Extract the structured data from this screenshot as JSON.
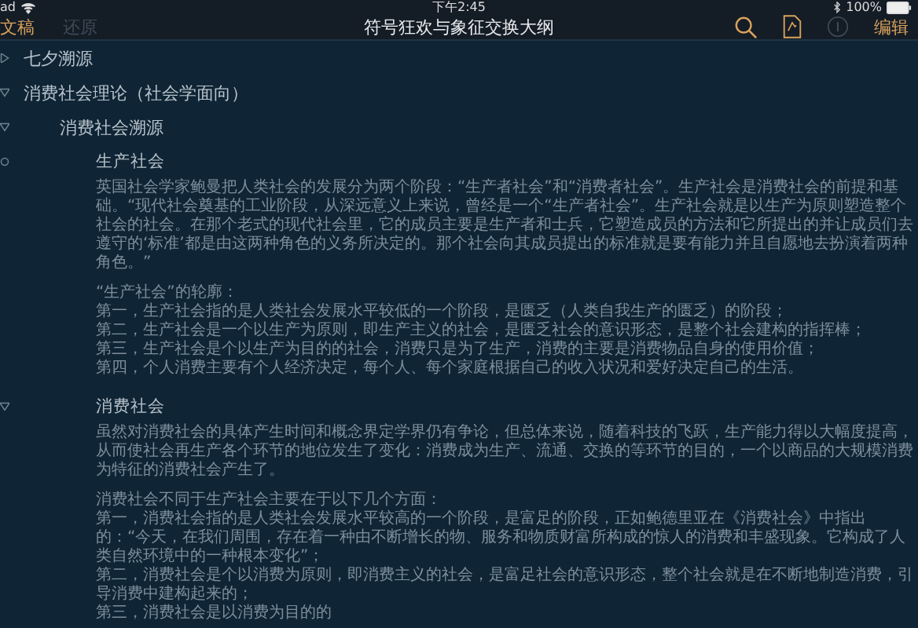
{
  "status_bar": {
    "device": "ad",
    "time": "下午2:45",
    "battery": "100%"
  },
  "nav": {
    "back": "文稿",
    "revert": {
      "label": "还原",
      "disabled": true
    },
    "title": "符号狂欢与象征交换大纲",
    "info_disabled": true,
    "edit": "编辑"
  },
  "outline": [
    {
      "title": "七夕溯源",
      "expanded": false
    },
    {
      "title": "消费社会理论（社会学面向）",
      "expanded": true,
      "children": [
        {
          "title": "消费社会溯源",
          "expanded": true,
          "children": [
            {
              "title": "生产社会",
              "notes": [
                [
                  "英国社会学家鲍曼把人类社会的发展分为两个阶段：“生产者社会”和“消费者社会”。生产社会是消费社会的前提和基础。“现代社会奠基的工业阶段，从深远意义上来说，曾经是一个“生产者社会”。生产社会就是以生产为原则塑造整个社会的社会。在那个老式的现代社会里，它的成员主要是生产者和士兵，它塑造成员的方法和它所提出的并让成员们去遵守的‘标准’都是由这两种角色的义务所决定的。那个社会向其成员提出的标准就是要有能力并且自愿地去扮演着两种角色。”"
                ],
                [
                  "“生产社会”的轮廓：",
                  "第一，生产社会指的是人类社会发展水平较低的一个阶段，是匮乏（人类自我生产的匮乏）的阶段；",
                  "第二，生产社会是一个以生产为原则，即生产主义的社会，是匮乏社会的意识形态，是整个社会建构的指挥棒；",
                  "第三，生产社会是个以生产为目的的社会，消费只是为了生产，消费的主要是消费物品自身的使用价值；",
                  "第四，个人消费主要有个人经济决定，每个人、每个家庭根据自己的收入状况和爱好决定自己的生活。"
                ]
              ]
            },
            {
              "title": "消费社会",
              "expanded": true,
              "notes": [
                [
                  "虽然对消费社会的具体产生时间和概念界定学界仍有争论，但总体来说，随着科技的飞跃，生产能力得以大幅度提高，从而使社会再生产各个环节的地位发生了变化：消费成为生产、流通、交换的等环节的目的，一个以商品的大规模消费为特征的消费社会产生了。"
                ],
                [
                  "消费社会不同于生产社会主要在于以下几个方面：",
                  "第一，消费社会指的是人类社会发展水平较高的一个阶段，是富足的阶段，正如鲍德里亚在《消费社会》中指出的：“今天，在我们周围，存在着一种由不断增长的物、服务和物质财富所构成的惊人的消费和丰盛现象。它构成了人类自然环境中的一种根本变化”；",
                  "第二，消费社会是个以消费为原则，即消费主义的社会，是富足社会的意识形态，整个社会就是在不断地制造消费，引导消费中建构起来的；",
                  "第三，消费社会是以消费为目的的"
                ]
              ]
            }
          ]
        }
      ]
    }
  ]
}
